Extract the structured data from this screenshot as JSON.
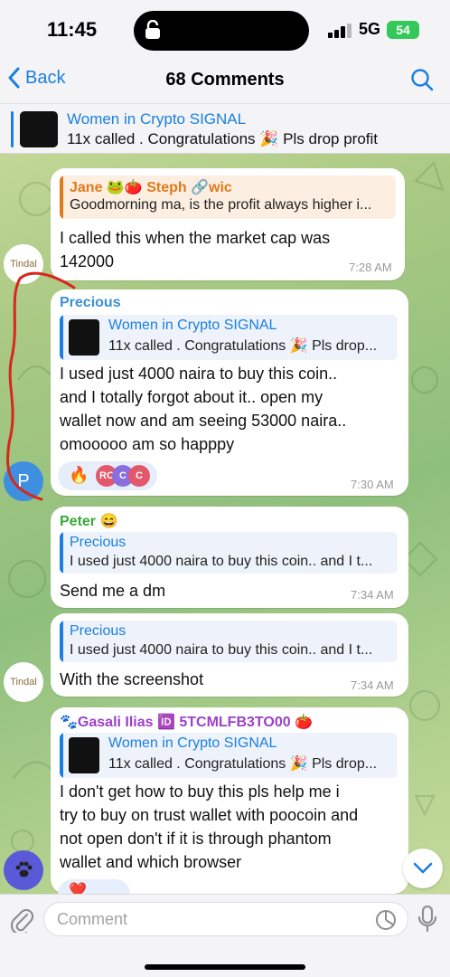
{
  "status": {
    "time": "11:45",
    "network": "5G",
    "battery": "54"
  },
  "nav": {
    "back_label": "Back",
    "title": "68 Comments"
  },
  "pinned": {
    "title": "Women in Crypto SIGNAL",
    "text": "11x called . Congratulations 🎉 Pls drop profit"
  },
  "messages": {
    "m1": {
      "sender": "Jane 🐸🍅 Steph 🔗wic",
      "reply_text": "Goodmorning ma, is the profit always higher i...",
      "line1": "I called this when the market cap was",
      "line2": "142000",
      "time": "7:28 AM",
      "avatar": "Tindal"
    },
    "m2": {
      "sender": "Precious",
      "reply_title": "Women in Crypto SIGNAL",
      "reply_text": "11x called . Congratulations 🎉 Pls drop...",
      "line1": "I used just 4000 naira to buy this coin..",
      "line2": "and I totally forgot about it.. open my",
      "line3": "wallet now and am seeing 53000 naira..",
      "line4": "omooooo am so happpy",
      "reaction1": "🔥",
      "reaction2": "RC",
      "reaction3": "C",
      "reaction4": "C",
      "time": "7:30 AM",
      "avatar": "P"
    },
    "m3": {
      "sender": "Peter 😄",
      "reply_title": "Precious",
      "reply_text": "I used just 4000 naira to buy this coin.. and I t...",
      "text": "Send me a dm",
      "time": "7:34 AM"
    },
    "m4": {
      "reply_title": "Precious",
      "reply_text": "I used just 4000 naira to buy this coin.. and I t...",
      "text": "With the screenshot",
      "time": "7:34 AM",
      "avatar": "Tindal"
    },
    "m5": {
      "sender": "🐾Gasali Ilias 🆔 5TCMLFB3TO00 🍅",
      "reply_title": "Women in Crypto SIGNAL",
      "reply_text": "11x called . Congratulations 🎉 Pls drop...",
      "line1": "I don't get how to buy this pls help me i",
      "line2": "try to buy on trust wallet with poocoin and",
      "line3": "not open don't if it is through phantom",
      "line4": "wallet and which browser",
      "reaction1": "❤️"
    }
  },
  "input": {
    "placeholder": "Comment"
  },
  "colors": {
    "accent": "#1a7fe0",
    "precious": "#3a8fd6",
    "peter": "#3aa83a",
    "jane": "#e07a1a",
    "gasali": "#9b40c8"
  },
  "icons": [
    "lock-icon",
    "signal-icon",
    "back-chevron-icon",
    "search-icon",
    "attachment-icon",
    "sticker-icon",
    "microphone-icon",
    "scroll-down-icon"
  ]
}
